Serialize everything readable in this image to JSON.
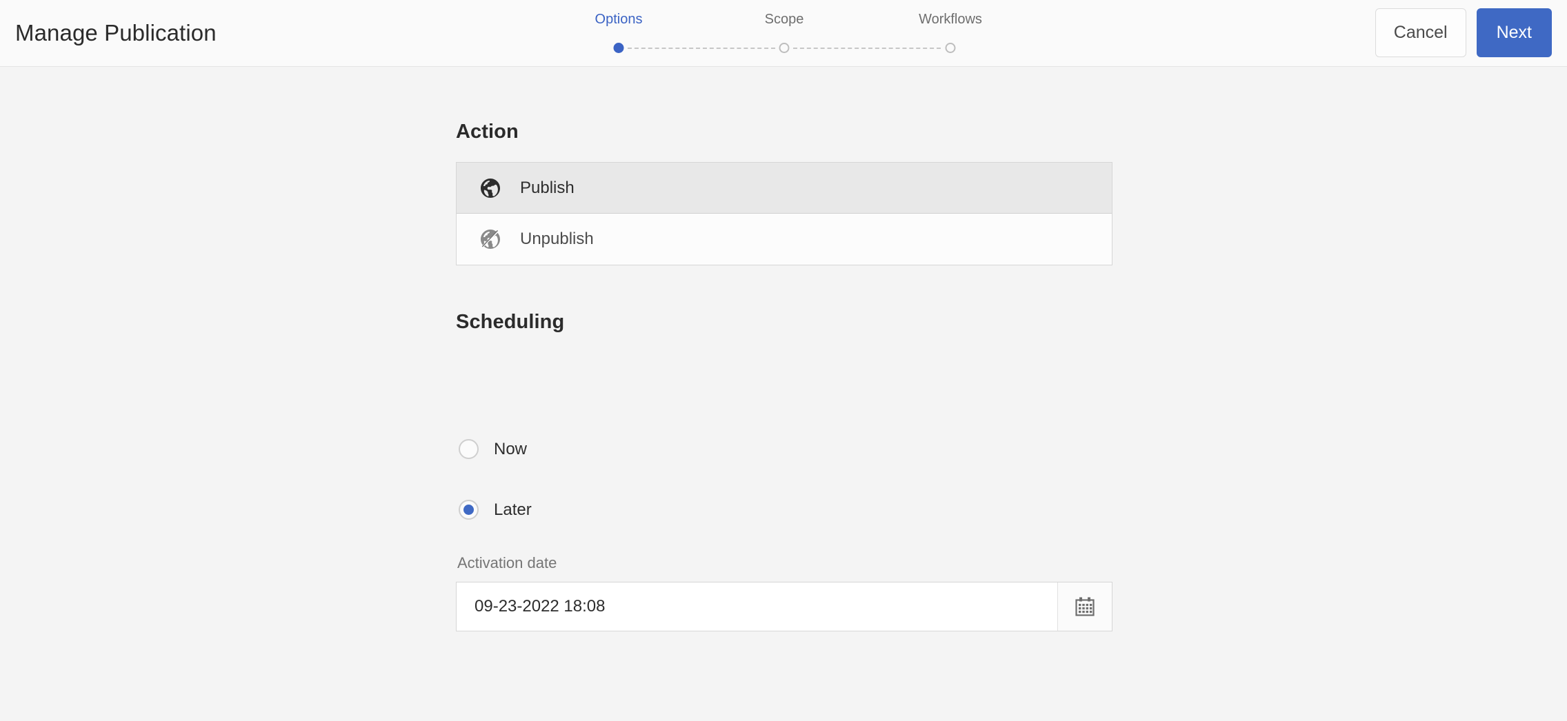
{
  "header": {
    "title": "Manage Publication",
    "cancel_label": "Cancel",
    "next_label": "Next"
  },
  "stepper": {
    "steps": [
      {
        "label": "Options",
        "state": "active"
      },
      {
        "label": "Scope",
        "state": "pending"
      },
      {
        "label": "Workflows",
        "state": "pending"
      }
    ],
    "active_color": "#3b63c4",
    "inactive_color": "#6e6e6e"
  },
  "main": {
    "action": {
      "heading": "Action",
      "options": [
        {
          "label": "Publish",
          "icon": "globe-icon",
          "selected": true
        },
        {
          "label": "Unpublish",
          "icon": "globe-slash-icon",
          "selected": false
        }
      ]
    },
    "scheduling": {
      "heading": "Scheduling",
      "radios": [
        {
          "label": "Now",
          "selected": false
        },
        {
          "label": "Later",
          "selected": true
        }
      ],
      "activation_date": {
        "label": "Activation date",
        "value": "09-23-2022 18:08",
        "placeholder": "",
        "picker_icon": "calendar-icon"
      }
    }
  },
  "colors": {
    "accent": "#3f69c4",
    "page_background": "#f4f4f4",
    "header_background": "#fafafa",
    "selected_row": "#e8e8e8"
  }
}
